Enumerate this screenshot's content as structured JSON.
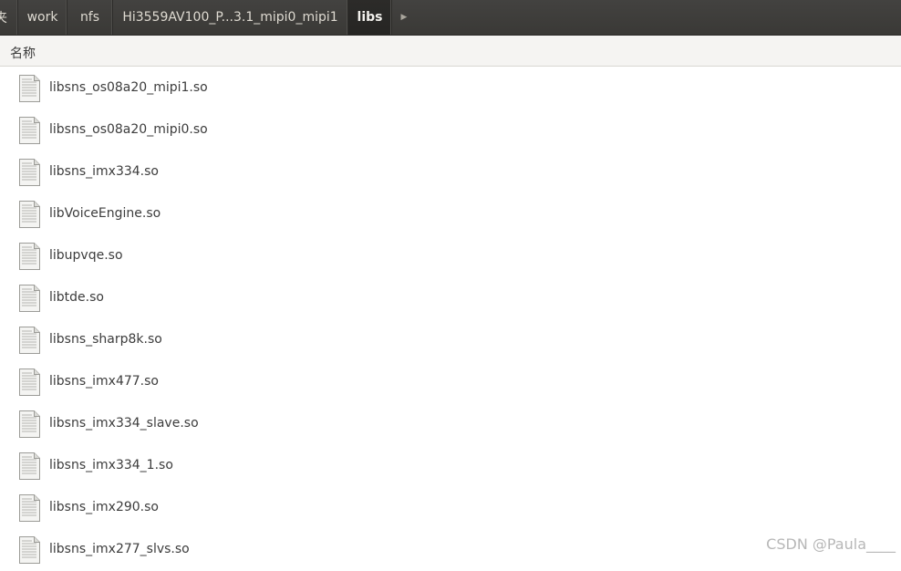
{
  "breadcrumb": {
    "items": [
      {
        "label": "夹",
        "state": "truncated"
      },
      {
        "label": "work",
        "state": "normal"
      },
      {
        "label": "nfs",
        "state": "normal"
      },
      {
        "label": "Hi3559AV100_P...3.1_mipi0_mipi1",
        "state": "normal"
      },
      {
        "label": "libs",
        "state": "active"
      }
    ],
    "forward_icon": "triangle-right-icon"
  },
  "list": {
    "column_header": "名称",
    "file_icon": "text-document-icon",
    "files": [
      {
        "name": "libsns_os08a20_mipi1.so"
      },
      {
        "name": "libsns_os08a20_mipi0.so"
      },
      {
        "name": "libsns_imx334.so"
      },
      {
        "name": "libVoiceEngine.so"
      },
      {
        "name": "libupvqe.so"
      },
      {
        "name": "libtde.so"
      },
      {
        "name": "libsns_sharp8k.so"
      },
      {
        "name": "libsns_imx477.so"
      },
      {
        "name": "libsns_imx334_slave.so"
      },
      {
        "name": "libsns_imx334_1.so"
      },
      {
        "name": "libsns_imx290.so"
      },
      {
        "name": "libsns_imx277_slvs.so"
      }
    ]
  },
  "watermark": "CSDN @Paula____",
  "colors": {
    "pathbar_bg": "#3e3d3a",
    "pathbar_active": "#2a2927",
    "text": "#3c3c3c",
    "header_bg": "#f5f4f2"
  }
}
